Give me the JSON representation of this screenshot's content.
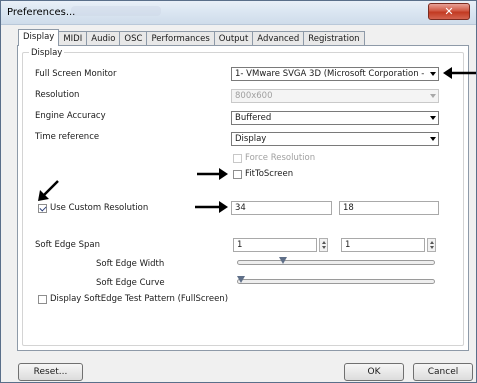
{
  "window": {
    "title": "Preferences..."
  },
  "tabs": [
    "Display",
    "MIDI",
    "Audio",
    "OSC",
    "Performances",
    "Output",
    "Advanced",
    "Registration"
  ],
  "display": {
    "group_label": "Display",
    "full_screen_monitor": {
      "label": "Full Screen Monitor",
      "value": "1- VMware SVGA 3D (Microsoft Corporation - V"
    },
    "resolution": {
      "label": "Resolution",
      "value": "800x600"
    },
    "engine_accuracy": {
      "label": "Engine Accuracy",
      "value": "Buffered"
    },
    "time_reference": {
      "label": "Time reference",
      "value": "Display"
    },
    "force_resolution": {
      "label": "Force Resolution",
      "checked": false
    },
    "fit_to_screen": {
      "label": "FitToScreen",
      "checked": false
    },
    "custom_resolution": {
      "label": "Use Custom Resolution",
      "checked": true,
      "width": "34",
      "height": "18"
    },
    "soft_edge_span": {
      "label": "Soft Edge Span",
      "value1": "1",
      "value2": "1"
    },
    "soft_edge_width": {
      "label": "Soft Edge Width",
      "level": 0.22
    },
    "soft_edge_curve": {
      "label": "Soft Edge Curve",
      "level": 0.0
    },
    "test_pattern": {
      "label": "Display SoftEdge Test Pattern (FullScreen)",
      "checked": false
    }
  },
  "buttons": {
    "reset": "Reset...",
    "ok": "OK",
    "cancel": "Cancel"
  }
}
